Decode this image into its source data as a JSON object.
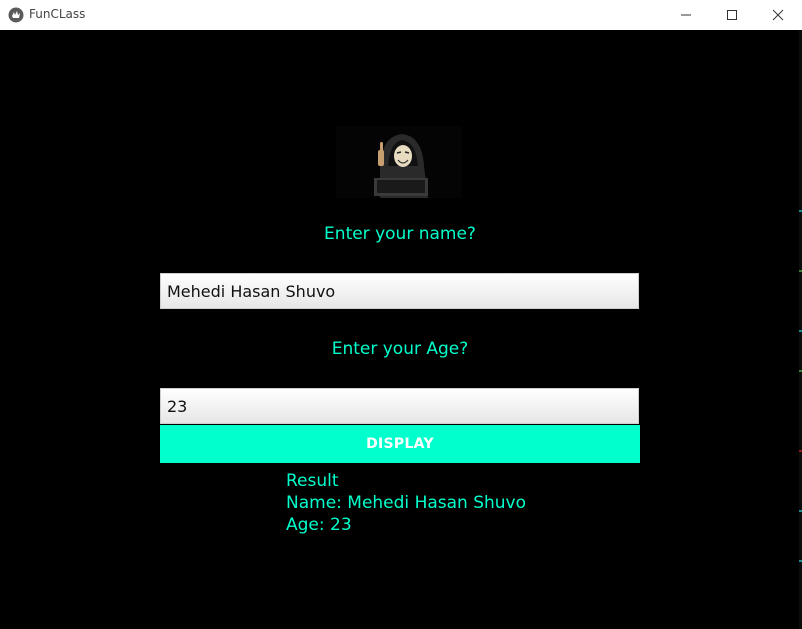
{
  "window": {
    "title": "FunCLass",
    "app_icon": "kivy-logo-icon",
    "controls": [
      "minimize-icon",
      "maximize-icon",
      "close-icon"
    ]
  },
  "avatar": {
    "icon": "hacker-avatar-icon"
  },
  "form": {
    "name_label": "Enter your name?",
    "name_value": "Mehedi Hasan Shuvo",
    "age_label": "Enter your Age?",
    "age_value": "23",
    "display_button": "DISPLAY"
  },
  "result": {
    "heading": "Result",
    "name_line": "Name: Mehedi Hasan Shuvo",
    "age_line": "Age: 23"
  },
  "colors": {
    "accent": "#00ffcc",
    "background": "#000000",
    "titlebar": "#ffffff"
  }
}
